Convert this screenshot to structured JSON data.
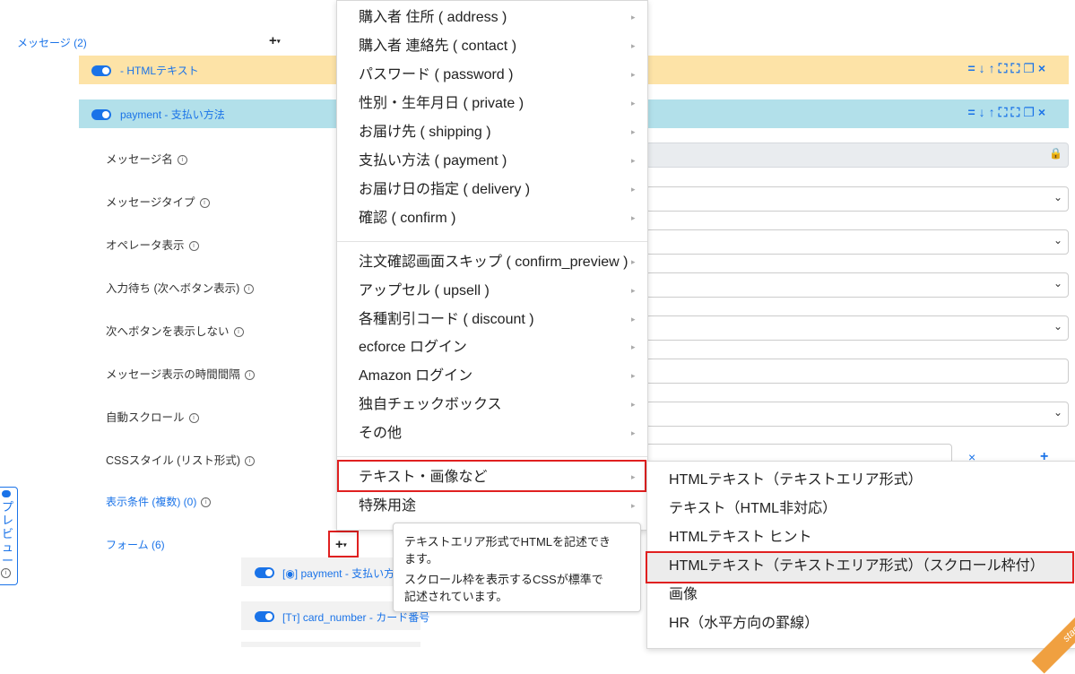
{
  "messages_link": "メッセージ (2)",
  "add_symbol": "+",
  "html_text_bar_title": "- HTMLテキスト",
  "payment_bar_title": "payment - 支払い方法",
  "settings": {
    "message_name": "メッセージ名",
    "message_type": "メッセージタイプ",
    "operator_display": "オペレータ表示",
    "wait_input": "入力待ち (次へボタン表示)",
    "hide_next": "次へボタンを表示しない",
    "display_interval": "メッセージ表示の時間間隔",
    "auto_scroll": "自動スクロール",
    "css_style": "CSSスタイル (リスト形式)",
    "display_conditions": "表示条件 (複数) (0)",
    "forms": "フォーム (6)"
  },
  "preview_label": "プレビュー",
  "form_rows": {
    "payment": "[◉] payment - 支払い方",
    "card_number": "[Tт] card_number - カード番号"
  },
  "menu_items": {
    "address": "購入者 住所 ( address )",
    "contact": "購入者 連絡先 ( contact )",
    "password": "パスワード ( password )",
    "private": "性別・生年月日 ( private )",
    "shipping": "お届け先 ( shipping )",
    "payment": "支払い方法 ( payment )",
    "delivery": "お届け日の指定 ( delivery )",
    "confirm": "確認 ( confirm )",
    "confirm_preview": "注文確認画面スキップ ( confirm_preview )",
    "upsell": "アップセル ( upsell )",
    "discount": "各種割引コード ( discount )",
    "ecforce_login": "ecforce ログイン",
    "amazon_login": "Amazon ログイン",
    "checkbox": "独自チェックボックス",
    "other": "その他",
    "text_image": "テキスト・画像など",
    "special": "特殊用途"
  },
  "submenu_items": {
    "html_textarea": "HTMLテキスト（テキストエリア形式）",
    "text_no_html": "テキスト（HTML非対応）",
    "html_hint": "HTMLテキスト ヒント",
    "html_scroll": "HTMLテキスト（テキストエリア形式）（スクロール枠付）",
    "image": "画像",
    "hr": "HR（水平方向の罫線）"
  },
  "tooltip": {
    "line1": "テキストエリア形式でHTMLを記述でき",
    "line2": "ます。",
    "line3": "スクロール枠を表示するCSSが標準で",
    "line4": "記述されています。"
  },
  "css_remove": "×",
  "css_add": "+",
  "staging_ribbon": "staging"
}
